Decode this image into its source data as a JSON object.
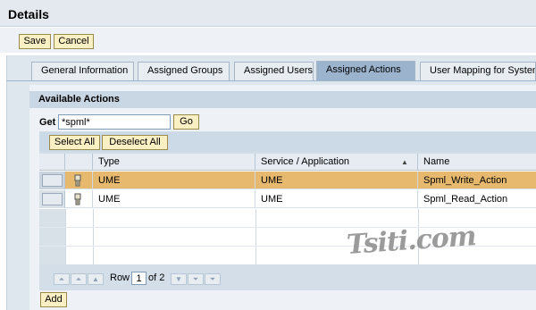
{
  "header": {
    "title": "Details"
  },
  "toolbar": {
    "save_label": "Save",
    "cancel_label": "Cancel"
  },
  "tabs": [
    {
      "label": "General Information",
      "active": false
    },
    {
      "label": "Assigned Groups",
      "active": false
    },
    {
      "label": "Assigned Users",
      "active": false
    },
    {
      "label": "Assigned Actions",
      "active": true
    },
    {
      "label": "User Mapping for System",
      "active": false
    }
  ],
  "panel": {
    "title": "Available Actions",
    "get_label": "Get",
    "get_value": "*spml*",
    "go_label": "Go",
    "select_all_label": "Select All",
    "deselect_all_label": "Deselect All"
  },
  "table": {
    "columns": [
      "Type",
      "Service / Application",
      "Name"
    ],
    "sorted_column": "Service / Application",
    "rows": [
      {
        "type": "UME",
        "service": "UME",
        "name": "Spml_Write_Action",
        "selected": true,
        "icon": "action-icon"
      },
      {
        "type": "UME",
        "service": "UME",
        "name": "Spml_Read_Action",
        "selected": false,
        "icon": "action-icon"
      }
    ]
  },
  "pager": {
    "row_label": "Row",
    "row_value": "1",
    "of_label": "of 2"
  },
  "footer": {
    "add_label": "Add"
  },
  "watermark": {
    "text": "Tsiti.com"
  },
  "colors": {
    "selected_row": "#e6b96e",
    "button_bg": "#fbf0c4",
    "active_tab": "#9bb3cc"
  }
}
